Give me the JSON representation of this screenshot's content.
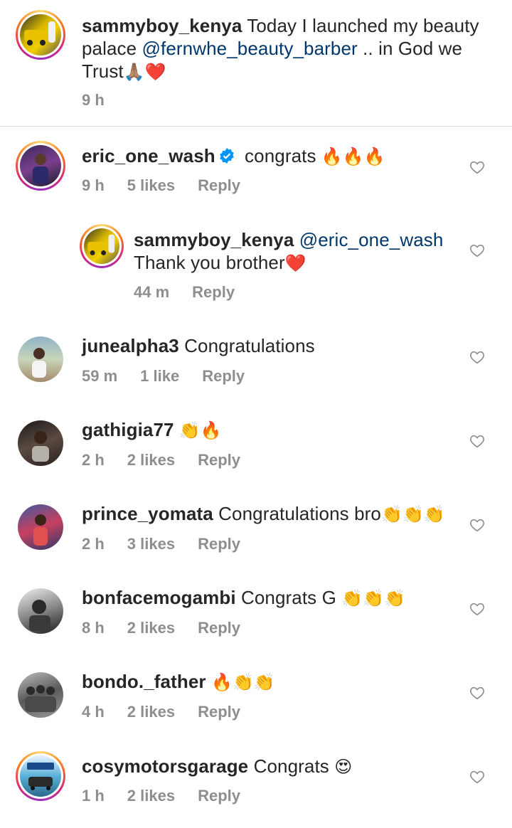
{
  "caption": {
    "username": "sammyboy_kenya",
    "text_before": " Today I launched my beauty palace ",
    "mention": "@fernwhe_beauty_barber",
    "text_after": " .. in God we Trust",
    "emojis": "🙏🏽❤️",
    "time": "9 h"
  },
  "comments": [
    {
      "username": "eric_one_wash",
      "verified": true,
      "text": " congrats ",
      "emojis": "🔥🔥🔥",
      "time": "9 h",
      "likes": "5 likes",
      "reply": "Reply",
      "avatar": "car-avatar-purple"
    },
    {
      "username": "sammyboy_kenya",
      "mention": "@eric_one_wash",
      "text": "Thank you brother",
      "emojis": "❤️",
      "time": "44 m",
      "reply": "Reply",
      "avatar": "car-avatar-yellow"
    },
    {
      "username": "junealpha3",
      "text": " Congratulations",
      "time": "59 m",
      "likes": "1 like",
      "reply": "Reply",
      "avatar": "person-avatar-beach"
    },
    {
      "username": "gathigia77",
      "text": " ",
      "emojis": "👏🔥",
      "time": "2 h",
      "likes": "2 likes",
      "reply": "Reply",
      "avatar": "person-avatar-dark"
    },
    {
      "username": "prince_yomata",
      "text": " Congratulations bro",
      "emojis": "👏👏👏",
      "time": "2 h",
      "likes": "3 likes",
      "reply": "Reply",
      "avatar": "person-avatar-blue"
    },
    {
      "username": "bonfacemogambi",
      "text": " Congrats G ",
      "emojis": "👏👏👏",
      "time": "8 h",
      "likes": "2 likes",
      "reply": "Reply",
      "avatar": "person-avatar-bw"
    },
    {
      "username": "bondo._father",
      "text": " ",
      "emojis": "🔥👏👏",
      "time": "4 h",
      "likes": "2 likes",
      "reply": "Reply",
      "avatar": "group-avatar-bw"
    },
    {
      "username": "cosymotorsgarage",
      "text": " Congrats ",
      "emojis": "😍",
      "time": "1 h",
      "likes": "2 likes",
      "reply": "Reply",
      "avatar": "garage-logo-avatar"
    }
  ],
  "icons": {
    "like": "heart-outline-icon",
    "verified": "verified-badge-icon"
  },
  "colors": {
    "text": "#262626",
    "secondary": "#8e8e8e",
    "mention": "#00376b",
    "verified": "#0095f6"
  }
}
